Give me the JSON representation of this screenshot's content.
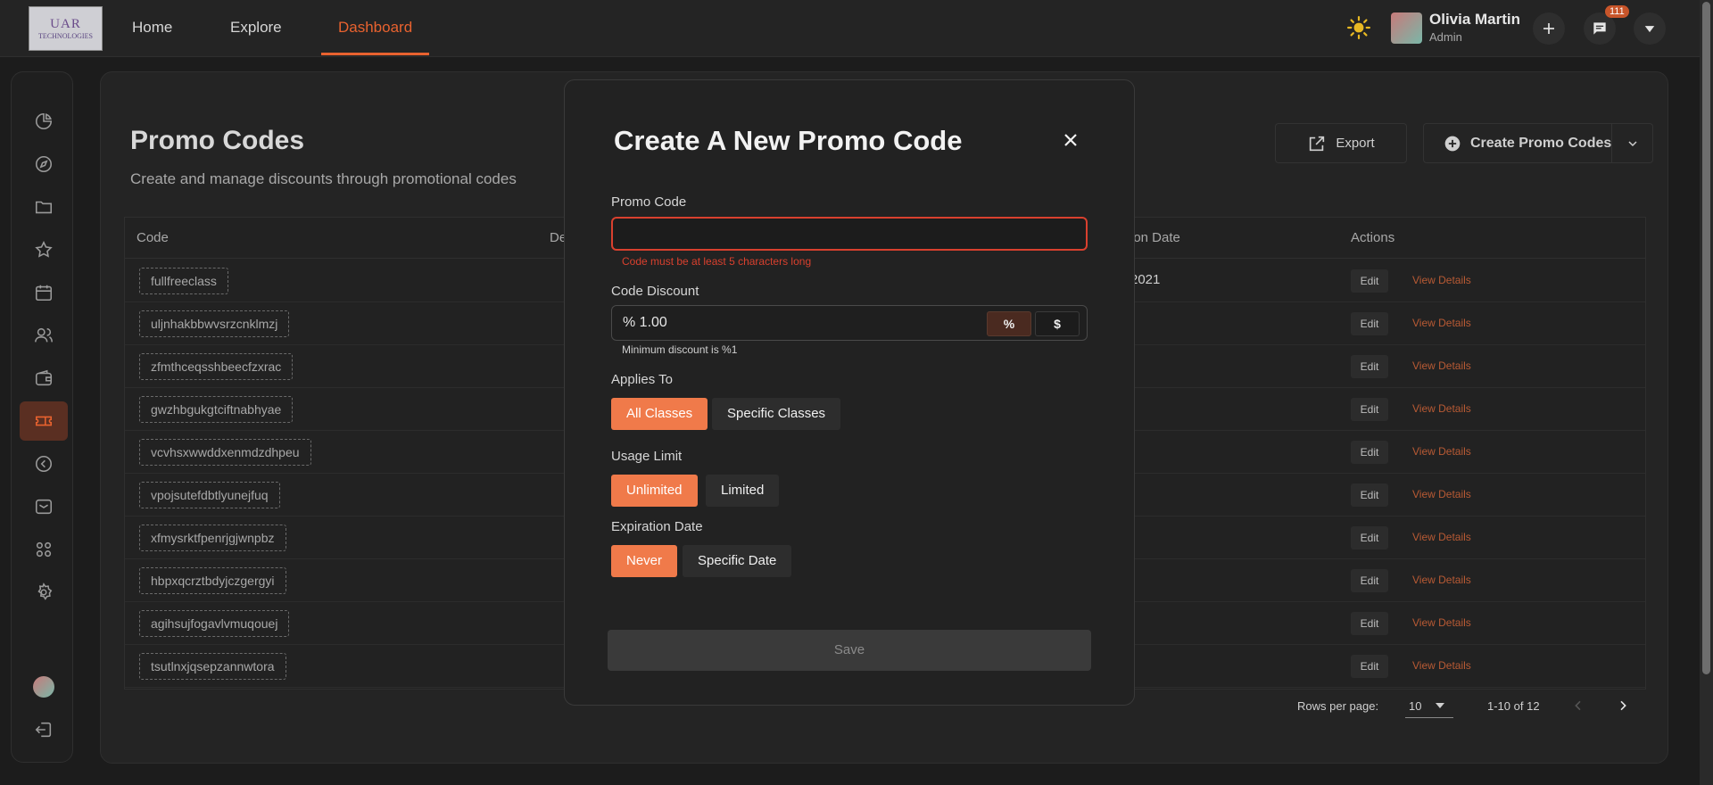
{
  "logo": {
    "line1": "UAR",
    "line2": "TECHNOLOGIES"
  },
  "nav": {
    "home": "Home",
    "explore": "Explore",
    "dashboard": "Dashboard"
  },
  "user": {
    "name": "Olivia Martin",
    "role": "Admin"
  },
  "notifications": {
    "count": "111"
  },
  "page": {
    "title": "Promo Codes",
    "subtitle": "Create and manage discounts through promotional codes",
    "export_label": "Export",
    "create_label": "Create Promo Codes"
  },
  "table": {
    "headers": {
      "code": "Code",
      "desc": "De",
      "exp": "ion Date",
      "actions": "Actions"
    },
    "edit_label": "Edit",
    "view_label": "View Details",
    "rows": [
      {
        "code": "fullfreeclass",
        "exp": "2021"
      },
      {
        "code": "uljnhakbbwvsrzcnklmzj",
        "exp": ""
      },
      {
        "code": "zfmthceqsshbeecfzxrac",
        "exp": ""
      },
      {
        "code": "gwzhbgukgtciftnabhyae",
        "exp": ""
      },
      {
        "code": "vcvhsxwwddxenmdzdhpeu",
        "exp": ""
      },
      {
        "code": "vpojsutefdbtlyunejfuq",
        "exp": ""
      },
      {
        "code": "xfmysrktfpenrjgjwnpbz",
        "exp": ""
      },
      {
        "code": "hbpxqcrztbdyjczgergyi",
        "exp": ""
      },
      {
        "code": "agihsujfogavlvmuqouej",
        "exp": ""
      },
      {
        "code": "tsutlnxjqsepzannwtora",
        "exp": ""
      }
    ]
  },
  "pagination": {
    "rows_label": "Rows per page:",
    "rows_value": "10",
    "range": "1-10 of 12"
  },
  "modal": {
    "title": "Create A New Promo Code",
    "promo_label": "Promo Code",
    "promo_value": "",
    "promo_error": "Code must be at least 5 characters long",
    "discount_label": "Code Discount",
    "discount_value": "% 1.00",
    "pct_symbol": "%",
    "usd_symbol": "$",
    "discount_hint": "Minimum discount is %1",
    "applies_label": "Applies To",
    "applies_all": "All Classes",
    "applies_specific": "Specific Classes",
    "usage_label": "Usage Limit",
    "usage_unlimited": "Unlimited",
    "usage_limited": "Limited",
    "expiration_label": "Expiration Date",
    "exp_never": "Never",
    "exp_specific": "Specific Date",
    "save_label": "Save"
  },
  "colors": {
    "accent": "#e8622f",
    "chip_active": "#f07a4a",
    "error": "#d9402e"
  }
}
